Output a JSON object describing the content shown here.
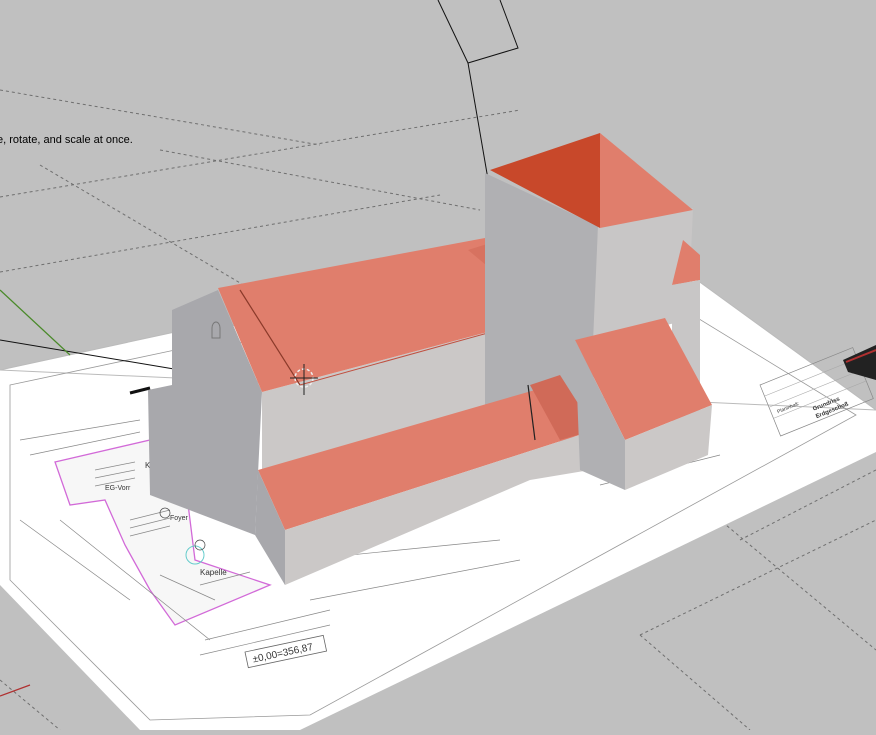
{
  "viewport": {
    "tool_hint": "e, rotate, and scale at once.",
    "elevation_label": "±0,00=356,87",
    "colors": {
      "background": "#c0c0c0",
      "roof": "#e07e6c",
      "roof_dark": "#c8482a",
      "wall_light": "#cbc8c7",
      "wall_mid": "#b0b0b3",
      "wall_dark": "#a8a8ac"
    },
    "plan_labels": {
      "room_1": "Kan",
      "room_2": "EG-Vorr",
      "room_3": "Foyer",
      "room_4": "Kapelle",
      "title_block_1": "Grundriss",
      "title_block_2": "Erdgeschoß",
      "title_block_3": "Planinhalt:"
    }
  }
}
